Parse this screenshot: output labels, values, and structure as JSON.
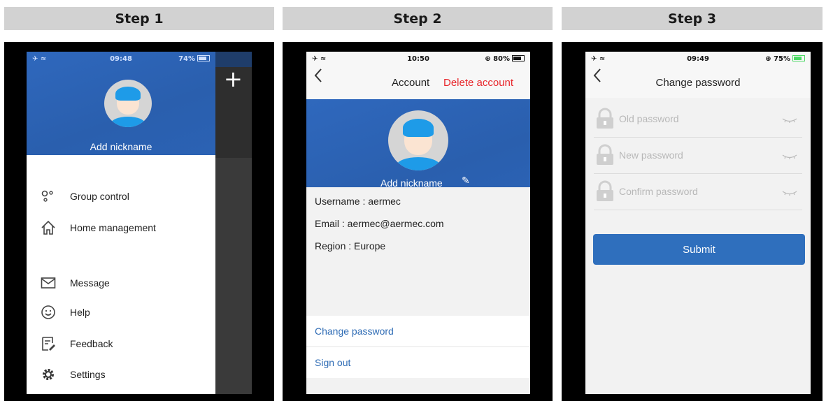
{
  "steps": [
    "Step 1",
    "Step 2",
    "Step 3"
  ],
  "step1": {
    "status": {
      "time": "09:48",
      "battery": "74%"
    },
    "nickname": "Add nickname",
    "menu": [
      {
        "label": "Group control",
        "icon": "group-control-icon"
      },
      {
        "label": "Home management",
        "icon": "home-icon"
      },
      {
        "label": "Message",
        "icon": "message-icon"
      },
      {
        "label": "Help",
        "icon": "help-icon"
      },
      {
        "label": "Feedback",
        "icon": "feedback-icon"
      },
      {
        "label": "Settings",
        "icon": "gear-icon"
      }
    ],
    "add_icon": "plus-icon"
  },
  "step2": {
    "status": {
      "time": "10:50",
      "battery": "80%"
    },
    "title": "Account",
    "delete_label": "Delete account",
    "nickname": "Add nickname",
    "username": "Username : aermec",
    "email": "Email : aermec@aermec.com",
    "region": "Region : Europe",
    "change_password": "Change password",
    "sign_out": "Sign out"
  },
  "step3": {
    "status": {
      "time": "09:49",
      "battery": "75%"
    },
    "title": "Change password",
    "fields": {
      "old": "Old password",
      "new": "New password",
      "confirm": "Confirm password"
    },
    "submit": "Submit"
  },
  "colors": {
    "header_blue": "#2a63b4",
    "accent_blue": "#2f6fbd",
    "delete_red": "#e8262b",
    "link_blue": "#2f6cb5"
  }
}
